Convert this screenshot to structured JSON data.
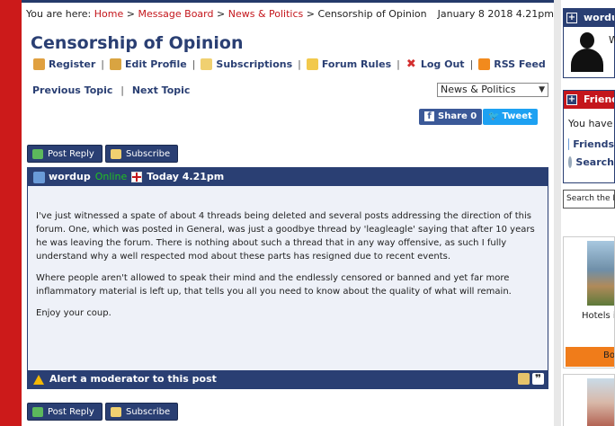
{
  "breadcrumb": {
    "prefix": "You are here:",
    "items": [
      "Home",
      "Message Board",
      "News & Politics"
    ],
    "current": "Censorship of Opinion",
    "separator": ">"
  },
  "date": "January 8 2018 4.21pm",
  "page_title": "Censorship of Opinion",
  "user_links": [
    "Register",
    "Edit Profile",
    "Subscriptions",
    "Forum Rules",
    "Log Out",
    "RSS Feed"
  ],
  "topic_nav": {
    "previous": "Previous Topic",
    "next": "Next Topic"
  },
  "forum_select": {
    "selected": "News & Politics"
  },
  "social": {
    "share": "Share 0",
    "tweet": "Tweet"
  },
  "actions": {
    "post_reply": "Post Reply",
    "subscribe": "Subscribe"
  },
  "post": {
    "author": "wordup",
    "status": "Online",
    "time": "Today 4.21pm",
    "paragraphs": [
      "I've just witnessed a spate of about 4 threads being deleted and several posts addressing the direction of this forum. One, which was posted in General, was just a goodbye thread by 'leagleagle' saying that after 10 years he was leaving the forum. There is nothing about such a thread that in any way offensive, as such I fully understand why a well respected mod about these parts has resigned due to recent events.",
      "Where people aren't allowed to speak their mind and the endlessly censored or banned and yet far more inflammatory material is left up, that tells you all you need to know about the quality of what will remain.",
      "Enjoy your coup."
    ],
    "alert": "Alert a moderator to this post"
  },
  "sidebar": {
    "user_box_title": "wordup",
    "user_box_text": "W",
    "friends_title": "Friends",
    "friends_text": "You have no",
    "friends_link": "Friends",
    "search_link": "Search",
    "search_placeholder": "Search the H",
    "ad_caption": "Hotels in Is",
    "ad_button": "Boo"
  },
  "colors": {
    "brand_navy": "#2a3f73",
    "link_red": "#c4161c",
    "background_red": "#cc1a1a",
    "online_green": "#21c021"
  }
}
